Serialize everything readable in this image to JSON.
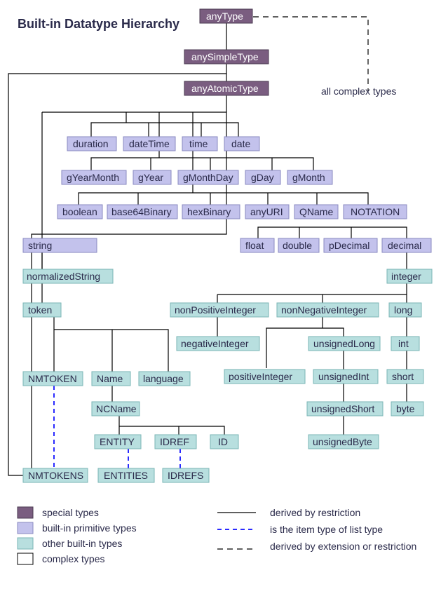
{
  "title": "Built-in Datatype Hierarchy",
  "complex_label": "all complex types",
  "boxes": {
    "anyType": "anyType",
    "anySimpleType": "anySimpleType",
    "anyAtomicType": "anyAtomicType",
    "duration": "duration",
    "dateTime": "dateTime",
    "time": "time",
    "date": "date",
    "gYearMonth": "gYearMonth",
    "gYear": "gYear",
    "gMonthDay": "gMonthDay",
    "gDay": "gDay",
    "gMonth": "gMonth",
    "boolean": "boolean",
    "base64Binary": "base64Binary",
    "hexBinary": "hexBinary",
    "anyURI": "anyURI",
    "QName": "QName",
    "NOTATION": "NOTATION",
    "string": "string",
    "float": "float",
    "double": "double",
    "pDecimal": "pDecimal",
    "decimal": "decimal",
    "normalizedString": "normalizedString",
    "integer": "integer",
    "token": "token",
    "nonPositiveInteger": "nonPositiveInteger",
    "nonNegativeInteger": "nonNegativeInteger",
    "long": "long",
    "negativeInteger": "negativeInteger",
    "unsignedLong": "unsignedLong",
    "int": "int",
    "NMTOKEN": "NMTOKEN",
    "Name": "Name",
    "language": "language",
    "positiveInteger": "positiveInteger",
    "unsignedInt": "unsignedInt",
    "short": "short",
    "NCName": "NCName",
    "unsignedShort": "unsignedShort",
    "byte": "byte",
    "ENTITY": "ENTITY",
    "IDREF": "IDREF",
    "ID": "ID",
    "unsignedByte": "unsignedByte",
    "NMTOKENS": "NMTOKENS",
    "ENTITIES": "ENTITIES",
    "IDREFS": "IDREFS"
  },
  "legend": {
    "special": "special types",
    "primitive": "built-in primitive types",
    "other": "other built-in types",
    "complex": "complex types",
    "restriction": "derived by restriction",
    "list": "is the item type of list type",
    "extension": "derived by extension or restriction"
  }
}
